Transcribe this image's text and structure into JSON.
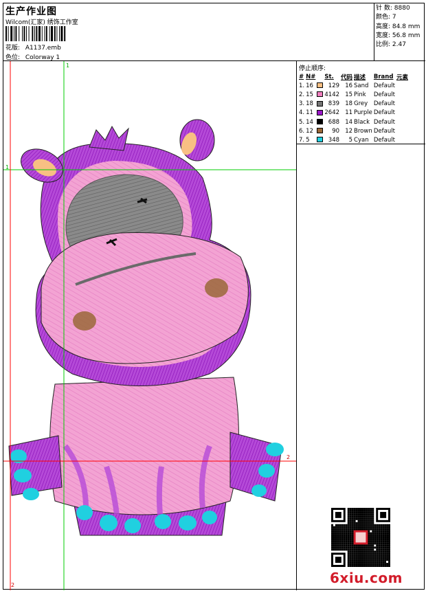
{
  "header": {
    "title": "生产作业图",
    "subtitle": "Wilcom(汇家) 绣饰工作室",
    "design_label": "花版:",
    "design_value": "A1137.emb",
    "colorway_label": "色位:",
    "colorway_value": "Colorway 1"
  },
  "stats": [
    {
      "label": "针 数:",
      "value": "8880"
    },
    {
      "label": "颜色:",
      "value": "7"
    },
    {
      "label": "高度:",
      "value": "84.8 mm"
    },
    {
      "label": "宽度:",
      "value": "56.8 mm"
    },
    {
      "label": "比例:",
      "value": "2.47"
    }
  ],
  "design_area": {
    "corner_top": "1",
    "corner_left": "1",
    "corner_bottom": "2",
    "corner_right": "2"
  },
  "stop_sequence": {
    "title": "停止顺序:",
    "columns": [
      "#",
      "N#",
      "",
      "St.",
      "代码",
      "描述",
      "Brand",
      "元素"
    ],
    "rows": [
      {
        "idx": "1.",
        "n": "16",
        "color": "#f8c083",
        "st": "129",
        "code": "16",
        "desc": "Sand",
        "brand": "Default"
      },
      {
        "idx": "2.",
        "n": "15",
        "color": "#f07fbf",
        "st": "4142",
        "code": "15",
        "desc": "Pink",
        "brand": "Default"
      },
      {
        "idx": "3.",
        "n": "18",
        "color": "#767676",
        "st": "839",
        "code": "18",
        "desc": "Grey",
        "brand": "Default"
      },
      {
        "idx": "4.",
        "n": "11",
        "color": "#9a16c8",
        "st": "2642",
        "code": "11",
        "desc": "Purple",
        "brand": "Default"
      },
      {
        "idx": "5.",
        "n": "14",
        "color": "#000000",
        "st": "688",
        "code": "14",
        "desc": "Black",
        "brand": "Default"
      },
      {
        "idx": "6.",
        "n": "12",
        "color": "#9a6838",
        "st": "90",
        "code": "12",
        "desc": "Brown",
        "brand": "Default"
      },
      {
        "idx": "7.",
        "n": "5",
        "color": "#20d0e0",
        "st": "348",
        "code": "5",
        "desc": "Cyan",
        "brand": "Default"
      }
    ]
  },
  "logo": {
    "text": "6xiu.com",
    "color": "#d21c2a"
  },
  "colors": {
    "guide_green": "#00cc00",
    "guide_red": "#ff0000",
    "pink": "#f07fbf",
    "purple": "#9a16c8",
    "grey": "#767676",
    "sand": "#f8c083",
    "brown": "#9a6838",
    "cyan": "#20d0e0"
  }
}
